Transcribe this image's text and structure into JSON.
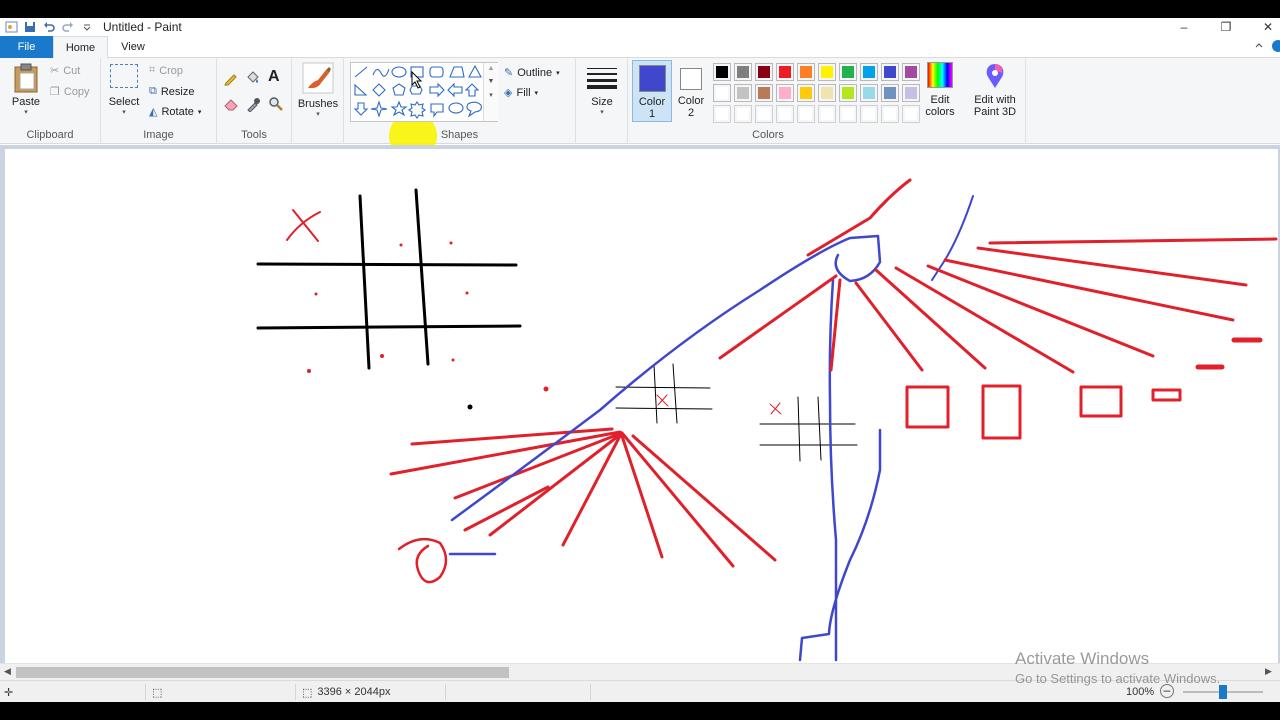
{
  "window": {
    "title": "Untitled - Paint",
    "controls": {
      "minimize": "–",
      "restore": "❐",
      "close": "✕"
    }
  },
  "tabs": [
    {
      "label": "File"
    },
    {
      "label": "Home"
    },
    {
      "label": "View"
    }
  ],
  "ribbon": {
    "clipboard": {
      "label": "Clipboard",
      "paste": "Paste",
      "cut": "Cut",
      "copy": "Copy"
    },
    "image": {
      "label": "Image",
      "select": "Select",
      "crop": "Crop",
      "resize": "Resize",
      "rotate": "Rotate"
    },
    "tools": {
      "label": "Tools"
    },
    "brushes": {
      "label": "Brushes"
    },
    "shapes": {
      "label": "Shapes",
      "outline": "Outline",
      "fill": "Fill"
    },
    "size": {
      "label": "Size"
    },
    "colors": {
      "label": "Colors",
      "color1_line1": "Color",
      "color1_line2": "1",
      "color2_line1": "Color",
      "color2_line2": "2",
      "edit_colors_line1": "Edit",
      "edit_colors_line2": "colors",
      "paint3d_line1": "Edit with",
      "paint3d_line2": "Paint 3D",
      "color1_value": "#3f48cc",
      "color2_value": "#ffffff",
      "palette_row1": [
        "#000000",
        "#7f7f7f",
        "#880015",
        "#ed1c24",
        "#ff7f27",
        "#fff200",
        "#22b14c",
        "#00a2e8",
        "#3f48cc",
        "#a349a4"
      ],
      "palette_row2": [
        "#ffffff",
        "#c3c3c3",
        "#b97a57",
        "#ffaec9",
        "#ffc90e",
        "#efe4b0",
        "#b5e61d",
        "#99d9ea",
        "#7092be",
        "#c8bfe7"
      ],
      "palette_row3": [
        "#ffffff",
        "#ffffff",
        "#ffffff",
        "#ffffff",
        "#ffffff",
        "#ffffff",
        "#ffffff",
        "#ffffff",
        "#ffffff",
        "#ffffff"
      ]
    }
  },
  "status": {
    "image_size": "3396 × 2044px",
    "zoom": "100%"
  },
  "watermark": {
    "title": "Activate Windows",
    "subtitle": "Go to Settings to activate Windows."
  }
}
